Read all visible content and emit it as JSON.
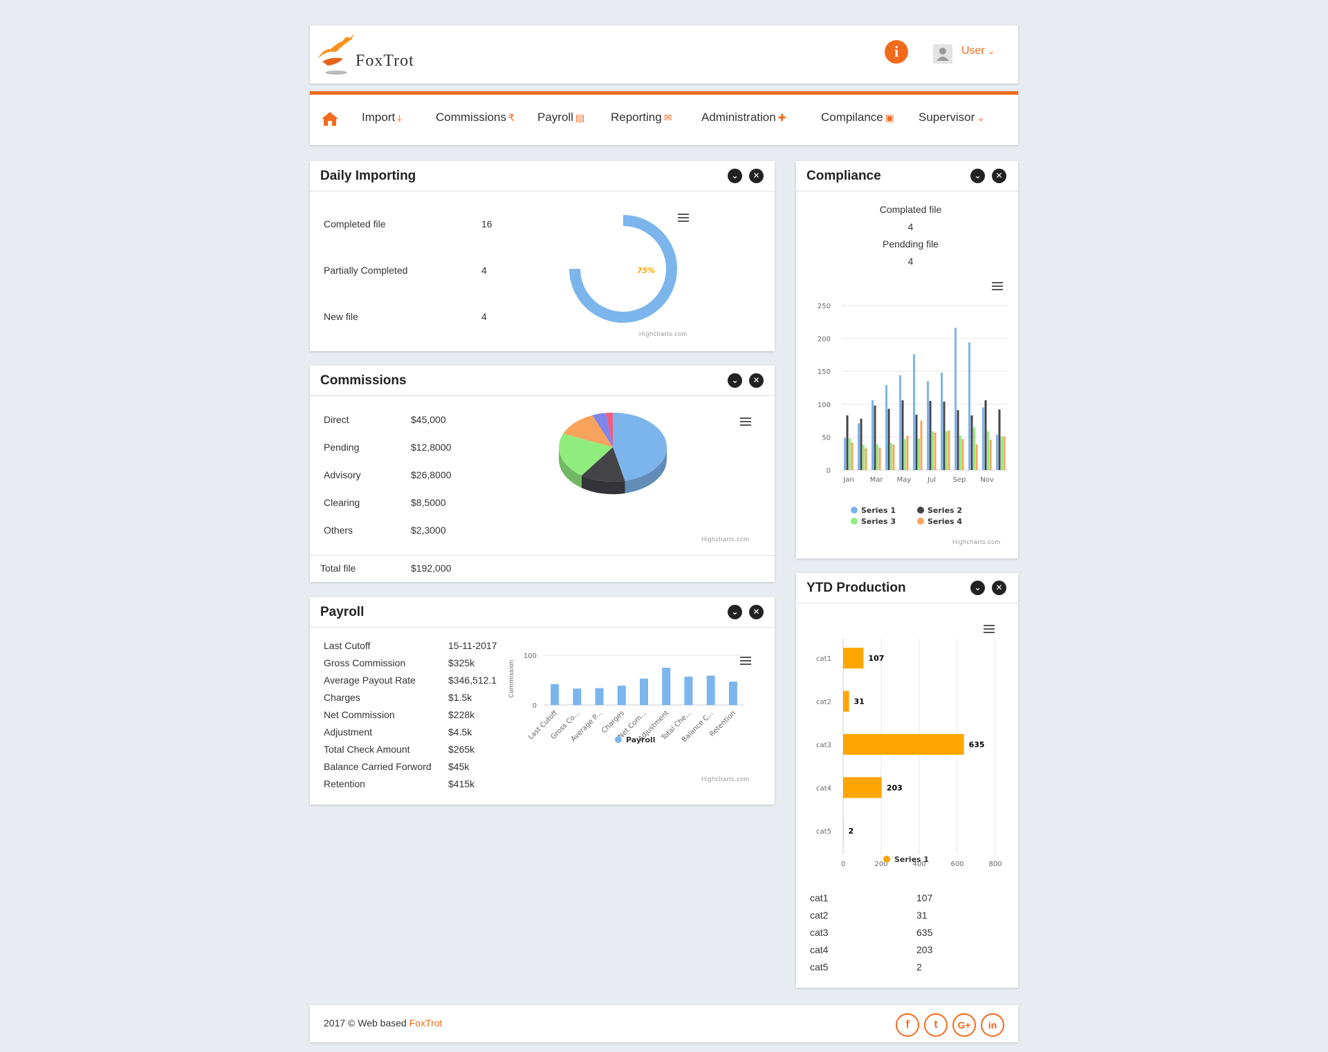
{
  "brand": {
    "name": "FoxTrot"
  },
  "header": {
    "info_icon": "info-icon",
    "user_label": "User",
    "user_chevron": "⌄"
  },
  "colors": {
    "accent": "#f26a1b",
    "orange": "#ffa500",
    "blue": "#7cb5ec",
    "dark": "#434348",
    "green": "#90ed7d",
    "peach": "#f7a35c"
  },
  "nav": {
    "home_icon": "home-icon",
    "items": [
      {
        "label": "Import",
        "icon": "⤓"
      },
      {
        "label": "Commissions",
        "icon": "₹"
      },
      {
        "label": "Payroll",
        "icon": "▤"
      },
      {
        "label": "Reporting",
        "icon": "✉"
      },
      {
        "label": "Administration",
        "icon": "✚"
      },
      {
        "label": "Compilance",
        "icon": "▣"
      },
      {
        "label": "Supervisor",
        "icon": "⌄"
      }
    ]
  },
  "daily_importing": {
    "title": "Daily Importing",
    "rows": [
      {
        "label": "Completed file",
        "value": "16"
      },
      {
        "label": "Partially Completed",
        "value": "4"
      },
      {
        "label": "New file",
        "value": "4"
      }
    ],
    "gauge_label": "75%",
    "credit": "Highcharts.com"
  },
  "commissions": {
    "title": "Commissions",
    "rows": [
      {
        "label": "Direct",
        "value": "$45,000"
      },
      {
        "label": "Pending",
        "value": "$12,8000"
      },
      {
        "label": "Advisory",
        "value": "$26,8000"
      },
      {
        "label": "Clearing",
        "value": "$8,5000"
      },
      {
        "label": "Others",
        "value": "$2,3000"
      }
    ],
    "total_label": "Total file",
    "total_value": "$192,000",
    "credit": "Highcharts.com"
  },
  "payroll": {
    "title": "Payroll",
    "rows": [
      {
        "label": "Last Cutoff",
        "value": "15-11-2017"
      },
      {
        "label": "Gross Commission",
        "value": "$325k"
      },
      {
        "label": "Average Payout Rate",
        "value": "$346,512.1"
      },
      {
        "label": "Charges",
        "value": "$1.5k"
      },
      {
        "label": "Net Commission",
        "value": "$228k"
      },
      {
        "label": "Adjustment",
        "value": "$4.5k"
      },
      {
        "label": "Total Check Amount",
        "value": "$265k"
      },
      {
        "label": "Balance Carried Forword",
        "value": "$45k"
      },
      {
        "label": "Retention",
        "value": "$415k"
      }
    ],
    "credit": "Highcharts.com"
  },
  "compliance": {
    "title": "Compliance",
    "completed_label": "Complated file",
    "completed_value": "4",
    "pending_label": "Pendding file",
    "pending_value": "4",
    "credit": "Highcharts.com"
  },
  "ytd": {
    "title": "YTD Production",
    "rows": [
      {
        "label": "cat1",
        "value": "107"
      },
      {
        "label": "cat2",
        "value": "31"
      },
      {
        "label": "cat3",
        "value": "635"
      },
      {
        "label": "cat4",
        "value": "203"
      },
      {
        "label": "cat5",
        "value": "2"
      }
    ]
  },
  "footer": {
    "text": "2017 © Web based ",
    "brand": "FoxTrot",
    "social": [
      "f",
      "t",
      "G+",
      "in"
    ]
  },
  "chart_data": [
    {
      "id": "daily_gauge",
      "type": "pie",
      "title": "",
      "values": [
        75
      ],
      "ylim": [
        0,
        100
      ],
      "data_labels": [
        "75%"
      ]
    },
    {
      "id": "commissions_pie",
      "type": "pie",
      "title": "",
      "series": [
        {
          "values": [
            45,
            13,
            21,
            12,
            4,
            2
          ]
        }
      ],
      "colors": [
        "#7cb5ec",
        "#434348",
        "#90ed7d",
        "#f7a35c",
        "#8085e9",
        "#f15c80"
      ]
    },
    {
      "id": "payroll_column",
      "type": "bar",
      "title": "",
      "ylabel": "Commission",
      "categories": [
        "Last Cutoff",
        "Gross Co...",
        "Average P...",
        "Charges",
        "Net Com...",
        "Adjustment",
        "Total Che...",
        "Balance C...",
        "Retention"
      ],
      "yticks": [
        "0",
        "100"
      ],
      "ylim": [
        0,
        100
      ],
      "series": [
        {
          "name": "Payroll",
          "values": [
            42,
            33,
            34,
            39,
            53,
            75,
            57,
            59,
            47
          ]
        }
      ]
    },
    {
      "id": "compliance_column",
      "type": "bar",
      "title": "",
      "categories": [
        "Jan",
        "Feb",
        "Mar",
        "Apr",
        "May",
        "Jun",
        "Jul",
        "Aug",
        "Sep",
        "Oct",
        "Nov",
        "Dec"
      ],
      "xticks": [
        "Jan",
        "Mar",
        "May",
        "Jul",
        "Sep",
        "Nov"
      ],
      "yticks": [
        "0",
        "50",
        "100",
        "150",
        "200",
        "250"
      ],
      "ylim": [
        0,
        250
      ],
      "series": [
        {
          "name": "Series 1",
          "values": [
            49,
            71,
            106,
            129,
            144,
            176,
            135,
            148,
            216,
            194,
            95,
            54
          ]
        },
        {
          "name": "Series 2",
          "values": [
            83,
            78,
            98,
            93,
            106,
            84,
            105,
            104,
            91,
            83,
            106,
            92
          ]
        },
        {
          "name": "Series 3",
          "values": [
            48,
            38,
            39,
            41,
            47,
            48,
            59,
            59,
            52,
            65,
            59,
            51
          ]
        },
        {
          "name": "Series 4",
          "values": [
            42,
            33,
            34,
            39,
            52,
            75,
            57,
            60,
            47,
            39,
            46,
            51
          ]
        }
      ]
    },
    {
      "id": "ytd_bar",
      "type": "bar",
      "orientation": "horizontal",
      "title": "",
      "categories": [
        "cat1",
        "cat2",
        "cat3",
        "cat4",
        "cat5"
      ],
      "xticks": [
        "0",
        "200",
        "400",
        "600",
        "800"
      ],
      "xlim": [
        0,
        800
      ],
      "series": [
        {
          "name": "Series 1",
          "values": [
            107,
            31,
            635,
            203,
            2
          ]
        }
      ],
      "data_labels": [
        "107",
        "31",
        "635",
        "203",
        "2"
      ]
    }
  ]
}
